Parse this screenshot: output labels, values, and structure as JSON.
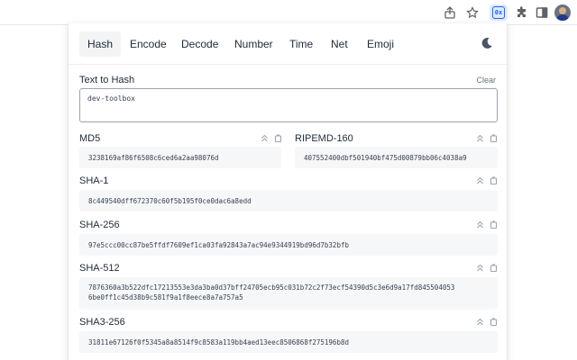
{
  "browser": {
    "toolbar_icons": [
      "share-icon",
      "star-icon",
      "extension-active-icon",
      "puzzle-icon",
      "sidebar-icon",
      "avatar"
    ],
    "extension_badge": "0x"
  },
  "tabs": [
    {
      "label": "Hash",
      "active": true
    },
    {
      "label": "Encode",
      "active": false
    },
    {
      "label": "Decode",
      "active": false
    },
    {
      "label": "Number",
      "active": false
    },
    {
      "label": "Time",
      "active": false
    },
    {
      "label": "Net",
      "active": false
    },
    {
      "label": "Emoji",
      "active": false
    }
  ],
  "input": {
    "label": "Text to Hash",
    "clear_label": "Clear",
    "value": "dev-toolbox"
  },
  "hashes": {
    "md5": {
      "label": "MD5",
      "value": "3238169af86f6508c6ced6a2aa98076d"
    },
    "ripemd160": {
      "label": "RIPEMD-160",
      "value": "407552400dbf501940bf475d00879bb06c4038a9"
    },
    "sha1": {
      "label": "SHA-1",
      "value": "8c449540dff672370c60f5b195f0ce0dac6a8edd"
    },
    "sha256": {
      "label": "SHA-256",
      "value": "97e5ccc00cc87be5ffdf7609ef1ca03fa92843a7ac94e9344919bd96d7b32bfb"
    },
    "sha512": {
      "label": "SHA-512",
      "value": "7876360a3b522dfc17213553e3da3ba0d37bff24705ecb95c031b72c2f73ecf54390d5c3e6d9a17fd845504053\n6be0ff1c45d38b9c581f9a1f8eece8a7a757a5"
    },
    "sha3_256": {
      "label": "SHA3-256",
      "value": "31811e67126f0f5345a8a8514f9c8583a119bb4aed13eec8506868f275196b8d"
    }
  },
  "colors": {
    "accent": "#2563eb",
    "value_bg": "#f6f7f9",
    "active_tab_bg": "#f3f4f6"
  }
}
